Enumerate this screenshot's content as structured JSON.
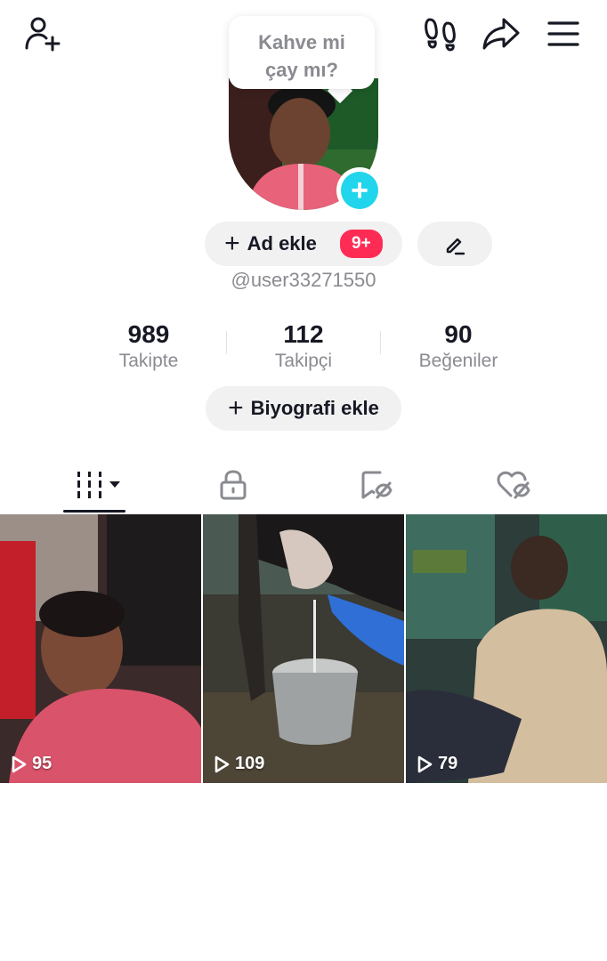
{
  "header": {
    "add_friend_icon": "person-add-icon",
    "footprints_icon": "footprints-icon",
    "share_icon": "share-icon",
    "menu_icon": "menu-icon"
  },
  "bubble": {
    "line1": "Kahve mi",
    "line2": "çay mı?"
  },
  "profile": {
    "add_name_label": "Ad ekle",
    "notification_badge": "9+",
    "username": "@user33271550",
    "bio_label": "Biyografi ekle"
  },
  "stats": [
    {
      "value": "989",
      "label": "Takipte"
    },
    {
      "value": "112",
      "label": "Takipçi"
    },
    {
      "value": "90",
      "label": "Beğeniler"
    }
  ],
  "tabs": [
    {
      "icon": "videos-grid-icon",
      "active": true
    },
    {
      "icon": "lock-icon",
      "active": false
    },
    {
      "icon": "bookmark-hidden-icon",
      "active": false
    },
    {
      "icon": "liked-hidden-icon",
      "active": false
    }
  ],
  "videos": [
    {
      "views": "95"
    },
    {
      "views": "109"
    },
    {
      "views": "79"
    }
  ],
  "colors": {
    "accent_red": "#fe2c55",
    "accent_cyan": "#20d5ec",
    "text_primary": "#161823",
    "text_secondary": "#8a8b91"
  }
}
